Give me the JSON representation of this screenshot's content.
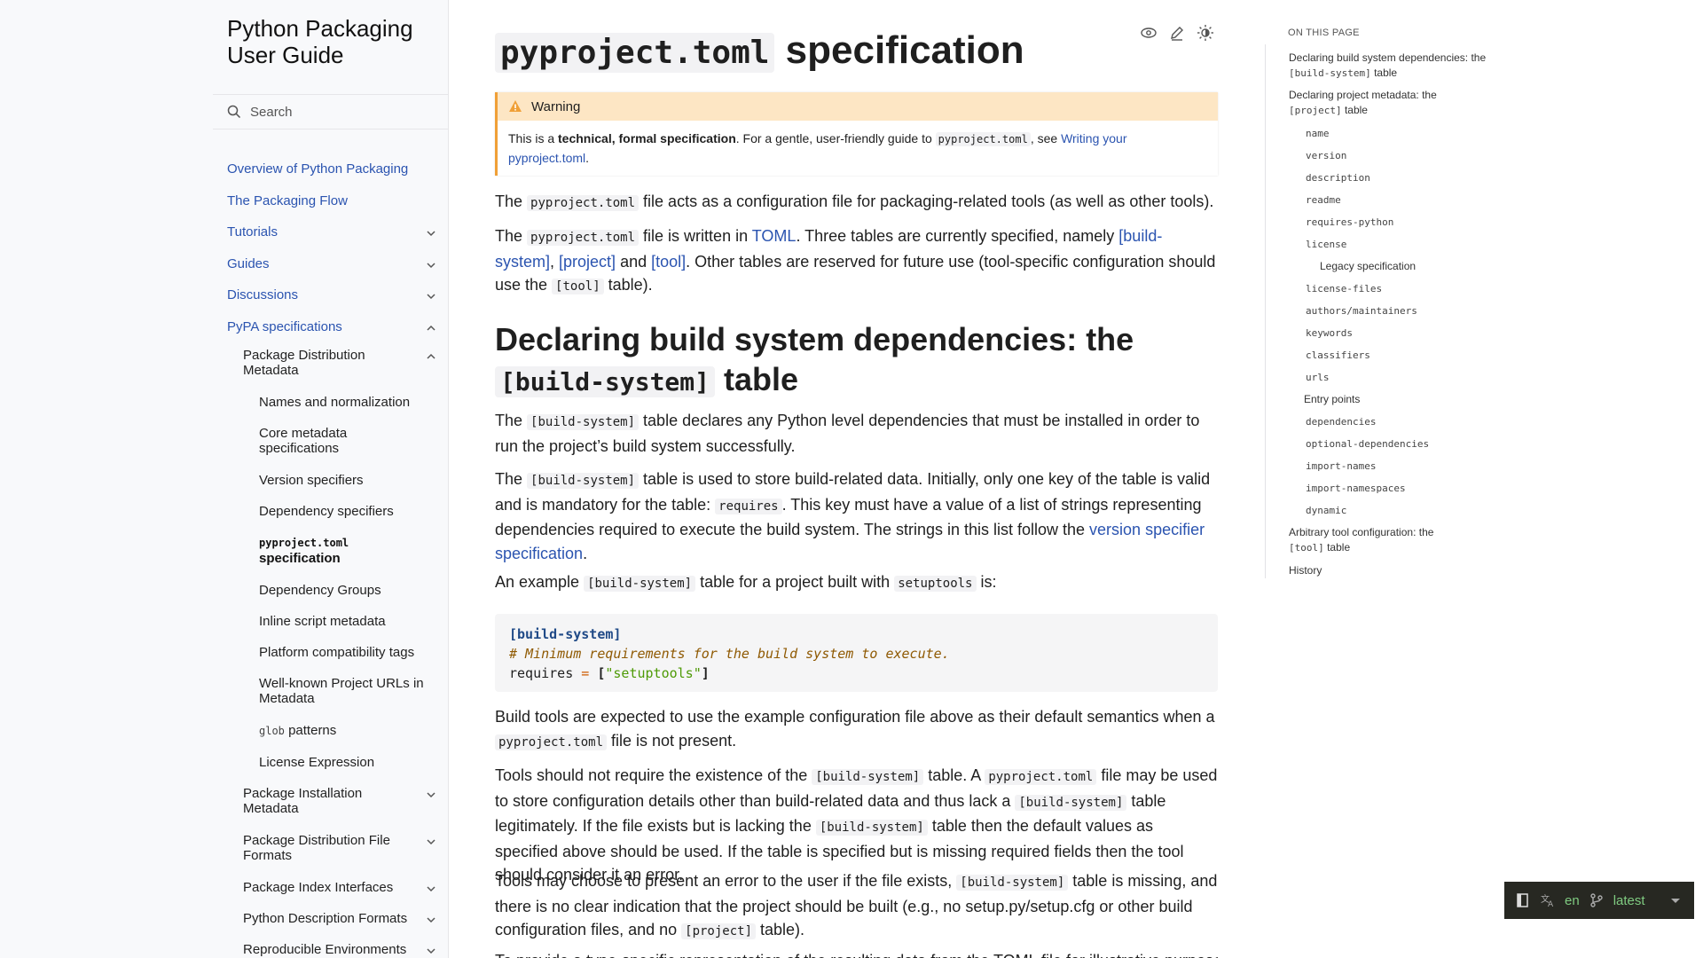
{
  "sidebar": {
    "site_title": "Python Packaging User Guide",
    "search_placeholder": "Search",
    "nav": [
      {
        "label": "Overview of Python Packaging",
        "level": 0
      },
      {
        "label": "The Packaging Flow",
        "level": 0
      },
      {
        "label": "Tutorials",
        "level": 0,
        "chevron": "down"
      },
      {
        "label": "Guides",
        "level": 0,
        "chevron": "down"
      },
      {
        "label": "Discussions",
        "level": 0,
        "chevron": "down"
      },
      {
        "label": "PyPA specifications",
        "level": 0,
        "chevron": "up"
      },
      {
        "label": "Package Distribution Metadata",
        "level": 1,
        "chevron": "up"
      },
      {
        "label": "Names and normalization",
        "level": 2
      },
      {
        "label": "Core metadata specifications",
        "level": 2
      },
      {
        "label": "Version specifiers",
        "level": 2
      },
      {
        "label": "Dependency specifiers",
        "level": 2
      },
      {
        "label_code": "pyproject.toml",
        "label": "specification",
        "level": 2,
        "current": true
      },
      {
        "label": "Dependency Groups",
        "level": 2
      },
      {
        "label": "Inline script metadata",
        "level": 2
      },
      {
        "label": "Platform compatibility tags",
        "level": 2
      },
      {
        "label": "Well-known Project URLs in Metadata",
        "level": 2
      },
      {
        "label_code": "glob",
        "label": "patterns",
        "level": 2
      },
      {
        "label": "License Expression",
        "level": 2
      },
      {
        "label": "Package Installation Metadata",
        "level": 1,
        "chevron": "down"
      },
      {
        "label": "Package Distribution File Formats",
        "level": 1,
        "chevron": "down"
      },
      {
        "label": "Package Index Interfaces",
        "level": 1,
        "chevron": "down"
      },
      {
        "label": "Python Description Formats",
        "level": 1,
        "chevron": "down"
      },
      {
        "label": "Reproducible Environments",
        "level": 1,
        "chevron": "down"
      }
    ]
  },
  "page": {
    "title_code": "pyproject.toml",
    "title_text": "specification",
    "warning": {
      "title": "Warning",
      "text_1": "This is a ",
      "text_bold": "technical, formal specification",
      "text_2": ". For a gentle, user-friendly guide to ",
      "text_code": "pyproject.toml",
      "text_3": ", see ",
      "link": "Writing your pyproject.toml",
      "text_4": "."
    },
    "p1": {
      "a": "The ",
      "code": "pyproject.toml",
      "b": " file acts as a configuration file for packaging-related tools (as well as other tools)."
    },
    "p2": {
      "a": "The ",
      "code": "pyproject.toml",
      "b": " file is written in ",
      "link_toml": "TOML",
      "c": ". Three tables are currently specified, namely ",
      "link_build": "[build-system]",
      "d": ", ",
      "link_project": "[project]",
      "e": " and ",
      "link_tool": "[tool]",
      "f": ". Other tables are reserved for future use (tool-specific configuration should use the ",
      "code2": "[tool]",
      "g": " table)."
    },
    "h2": {
      "text": "Declaring build system dependencies: the",
      "code": "[build-system]",
      "text2": "table"
    },
    "p3": {
      "a": "The ",
      "code": "[build-system]",
      "b": " table declares any Python level dependencies that must be installed in order to run the project’s build system successfully."
    },
    "p4": {
      "a": "The ",
      "code": "[build-system]",
      "b": " table is used to store build-related data. Initially, only one key of the table is valid and is mandatory for the table: ",
      "code2": "requires",
      "c": ". This key must have a value of a list of strings representing dependencies required to execute the build system. The strings in this list follow the ",
      "link": "version specifier specification",
      "d": "."
    },
    "p5": {
      "a": "An example ",
      "code": "[build-system]",
      "b": " table for a project built with ",
      "code2": "setuptools",
      "c": " is:"
    },
    "code": {
      "line1": "[build-system]",
      "line2": "# Minimum requirements for the build system to execute.",
      "line3_key": "requires",
      "line3_op": "=",
      "line3_open": "[",
      "line3_str": "\"setuptools\"",
      "line3_close": "]"
    },
    "p6": {
      "a": "Build tools are expected to use the example configuration file above as their default semantics when a ",
      "code": "pyproject.toml",
      "b": " file is not present."
    },
    "p7": {
      "a": "Tools should not require the existence of the ",
      "code": "[build-system]",
      "b": " table. A ",
      "code2": "pyproject.toml",
      "c": " file may be used to store configuration details other than build-related data and thus lack a ",
      "code3": "[build-system]",
      "d": " table legitimately. If the file exists but is lacking the ",
      "code4": "[build-system]",
      "e": " table then the default values as specified above should be used. If the table is specified but is missing required fields then the tool should consider it an error."
    },
    "p8": {
      "a": "Tools may choose to present an error to the user if the file exists, ",
      "code": "[build-system]",
      "b": " table is missing, and there is no clear indication that the project should be built (e.g., no setup.py/setup.cfg or other build configuration files, and no ",
      "code2": "[project]",
      "c": " table)."
    },
    "p9": "To provide a type-specific representation of the resulting data from the TOML file for illustrative purposes"
  },
  "toc": {
    "title": "ON THIS PAGE",
    "items": [
      {
        "text": "Declaring build system dependencies: the",
        "code": "[build-system]",
        "after": "table",
        "level": 0
      },
      {
        "text": "Declaring project metadata: the",
        "code": "[project]",
        "after": "table",
        "level": 0
      },
      {
        "code": "name",
        "level": 1
      },
      {
        "code": "version",
        "level": 1
      },
      {
        "code": "description",
        "level": 1
      },
      {
        "code": "readme",
        "level": 1
      },
      {
        "code": "requires-python",
        "level": 1
      },
      {
        "code": "license",
        "level": 1
      },
      {
        "text": "Legacy specification",
        "level": 2
      },
      {
        "code": "license-files",
        "level": 1
      },
      {
        "code": "authors/maintainers",
        "level": 1
      },
      {
        "code": "keywords",
        "level": 1
      },
      {
        "code": "classifiers",
        "level": 1
      },
      {
        "code": "urls",
        "level": 1
      },
      {
        "text": "Entry points",
        "level": 1
      },
      {
        "code": "dependencies",
        "level": 1
      },
      {
        "code": "optional-dependencies",
        "level": 1
      },
      {
        "code": "import-names",
        "level": 1
      },
      {
        "code": "import-namespaces",
        "level": 1
      },
      {
        "code": "dynamic",
        "level": 1
      },
      {
        "text": "Arbitrary tool configuration: the",
        "code": "[tool]",
        "after": "table",
        "level": 0
      },
      {
        "text": "History",
        "level": 0
      }
    ]
  },
  "flyout": {
    "language": "en",
    "version": "latest"
  },
  "colors": {
    "link": "#2b54b0",
    "warning_bg": "#fde6c4",
    "warning_border": "#f0a037",
    "flyout_bg": "#272822",
    "flyout_text": "#7fcb81"
  },
  "icons": [
    "search-icon",
    "chevron-down-icon",
    "chevron-up-icon",
    "view-source-icon",
    "edit-icon",
    "theme-toggle-icon",
    "warning-icon",
    "book-icon",
    "translate-icon",
    "branch-icon"
  ]
}
